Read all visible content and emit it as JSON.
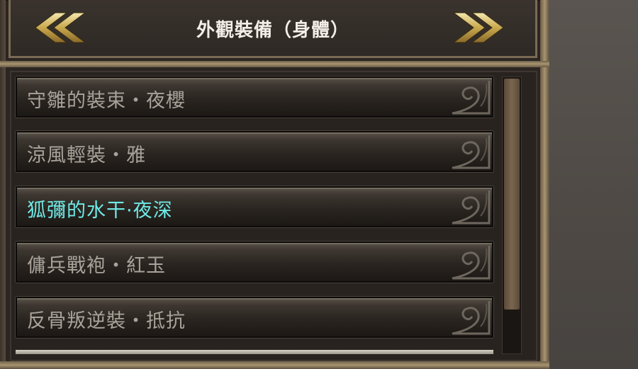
{
  "header": {
    "title": "外觀裝備（身體）",
    "prev_icon": "double-chevron-left-icon",
    "next_icon": "double-chevron-right-icon"
  },
  "list": {
    "items": [
      {
        "label": "守雛的裝束・夜櫻",
        "selected": false
      },
      {
        "label": "涼風輕裝・雅",
        "selected": false
      },
      {
        "label": "狐彌的水干·夜深",
        "selected": true
      },
      {
        "label": "傭兵戰袍・紅玉",
        "selected": false
      },
      {
        "label": "反骨叛逆裝・抵抗",
        "selected": false
      }
    ]
  },
  "colors": {
    "selected_text": "#6fe9e6",
    "normal_text": "#a9a39b",
    "title_text": "#f2efe8",
    "gold_frame": "#a8946f"
  }
}
